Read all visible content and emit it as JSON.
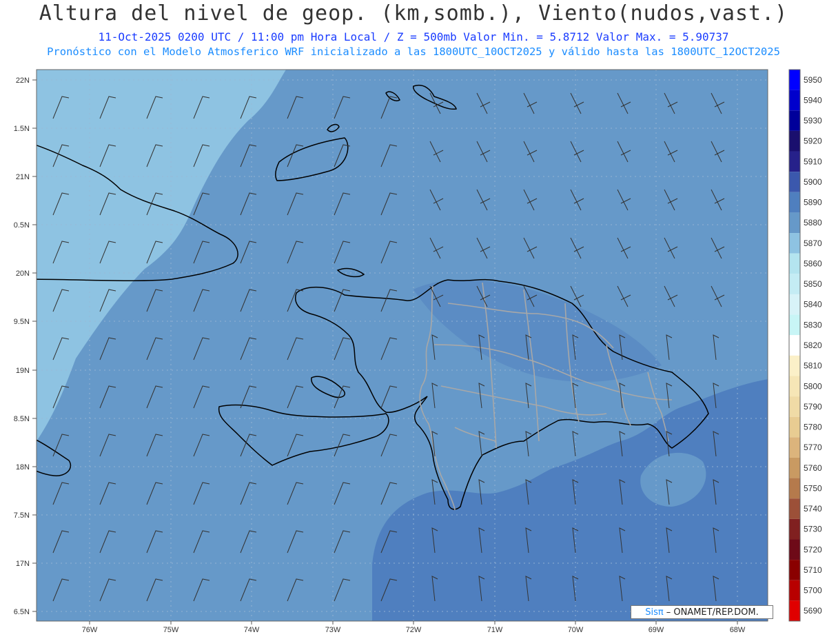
{
  "header": {
    "title": "Altura del nivel de geop. (km,somb.), Viento(nudos,vast.)",
    "subtitle1": "11-Oct-2025  0200 UTC / 11:00 pm Hora Local / Z = 500mb    Valor Min. = 5.8712  Valor Max. = 5.90737",
    "subtitle2": "Pronóstico con el Modelo Atmosferico WRF inicializado a las 1800UTC_10OCT2025 y válido hasta las  1800UTC_12OCT2025"
  },
  "axes": {
    "lat_labels": [
      "22N",
      "1.5N",
      "21N",
      "0.5N",
      "20N",
      "9.5N",
      "19N",
      "8.5N",
      "18N",
      "7.5N",
      "17N",
      "6.5N"
    ],
    "lon_labels": [
      "76W",
      "75W",
      "74W",
      "73W",
      "72W",
      "71W",
      "70W",
      "69W",
      "68W"
    ]
  },
  "colorbar": {
    "levels": [
      {
        "label": "5950",
        "color": "#0000ff"
      },
      {
        "label": "5940",
        "color": "#0000cc"
      },
      {
        "label": "5930",
        "color": "#00009a"
      },
      {
        "label": "5920",
        "color": "#1a0f6e"
      },
      {
        "label": "5910",
        "color": "#26218a"
      },
      {
        "label": "5900",
        "color": "#3b58ad"
      },
      {
        "label": "5890",
        "color": "#4f7fbf"
      },
      {
        "label": "5880",
        "color": "#6699c9"
      },
      {
        "label": "5870",
        "color": "#8ec3e2"
      },
      {
        "label": "5860",
        "color": "#b4e4ef"
      },
      {
        "label": "5850",
        "color": "#c4ecf4"
      },
      {
        "label": "5840",
        "color": "#d8f3f8"
      },
      {
        "label": "5830",
        "color": "#c8f5f6"
      },
      {
        "label": "5820",
        "color": "#ffffff"
      },
      {
        "label": "5810",
        "color": "#fbf0c8"
      },
      {
        "label": "5800",
        "color": "#f6e6b6"
      },
      {
        "label": "5790",
        "color": "#f0dba6"
      },
      {
        "label": "5780",
        "color": "#e8cc92"
      },
      {
        "label": "5770",
        "color": "#dcb47c"
      },
      {
        "label": "5760",
        "color": "#c99a62"
      },
      {
        "label": "5750",
        "color": "#b57a4c"
      },
      {
        "label": "5740",
        "color": "#9c5038"
      },
      {
        "label": "5730",
        "color": "#802020"
      },
      {
        "label": "5720",
        "color": "#6e0a18"
      },
      {
        "label": "5710",
        "color": "#8a0000"
      },
      {
        "label": "5700",
        "color": "#b80000"
      },
      {
        "label": "5690",
        "color": "#e00000"
      }
    ]
  },
  "credit": {
    "logo": "Sisπ",
    "text": "– ONAMET/REP.DOM."
  },
  "colors": {
    "light_zone": "#8ec3e2",
    "mid_zone": "#6699c9",
    "dark_zone": "#4f7fbf",
    "coast": "#000000",
    "provinces": "#a8a8a8"
  }
}
